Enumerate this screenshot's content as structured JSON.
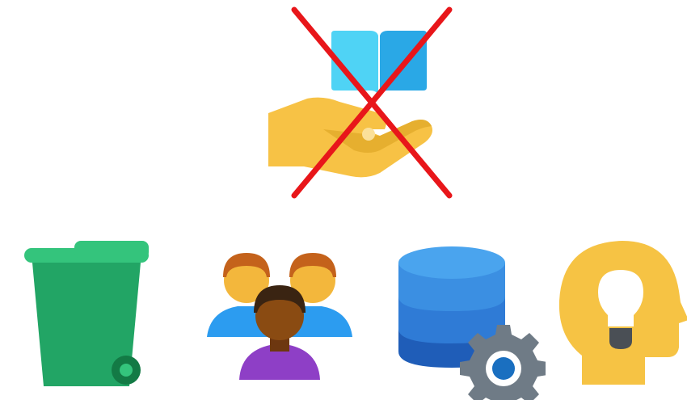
{
  "icons": [
    {
      "name": "hand-giving-book-icon",
      "crossed_out": true
    },
    {
      "name": "trash-bin-icon",
      "crossed_out": false
    },
    {
      "name": "user-group-icon",
      "crossed_out": false
    },
    {
      "name": "database-settings-icon",
      "crossed_out": false
    },
    {
      "name": "idea-head-icon",
      "crossed_out": false
    }
  ],
  "colors": {
    "cross": "#e8161a",
    "book_light": "#4fd3f5",
    "book_dark": "#2aa8e6",
    "hand": "#f7c245",
    "hand_shadow": "#d9a01d",
    "bin": "#22a565",
    "bin_lid": "#34c47c",
    "wheel": "#137a45",
    "hair_orange": "#c4621b",
    "skin_light": "#f3b73c",
    "shirt_blue": "#2c9cf0",
    "skin_dark": "#8a4b12",
    "shirt_purple": "#8e3fc6",
    "db_top": "#4aa4ee",
    "db_mid": "#2f7bd6",
    "db_low": "#1f5db8",
    "gear": "#6f7b86",
    "gear_center": "#1a6fc0",
    "head": "#f6c344",
    "bulb": "#ffffff",
    "bulb_base": "#4a4f55"
  }
}
